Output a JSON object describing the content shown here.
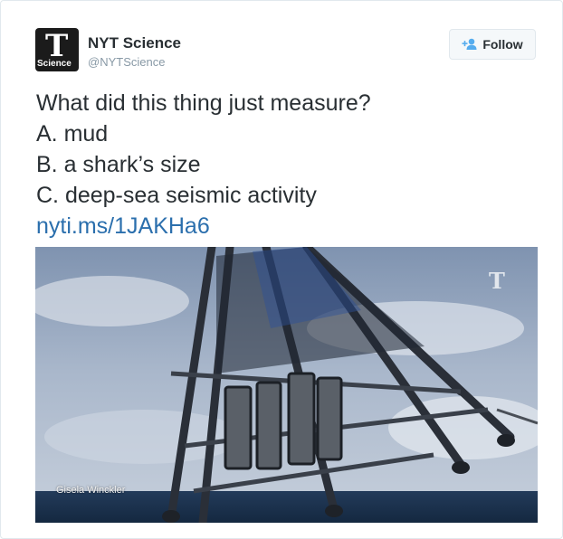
{
  "account": {
    "name": "NYT Science",
    "handle": "@NYTScience",
    "avatar_glyph": "T",
    "avatar_label": "Science"
  },
  "follow_button": {
    "label": "Follow",
    "icon": "add-user-icon"
  },
  "tweet": {
    "lines": [
      "What did this thing just measure?",
      "A. mud",
      "B. a shark’s size",
      "C. deep-sea seismic activity"
    ],
    "link": "nyti.ms/1JAKHa6"
  },
  "media": {
    "credit": "Gisela Winckler",
    "watermark": "T"
  },
  "colors": {
    "link": "#2b6fad",
    "text": "#292f33",
    "muted": "#8899a6"
  }
}
